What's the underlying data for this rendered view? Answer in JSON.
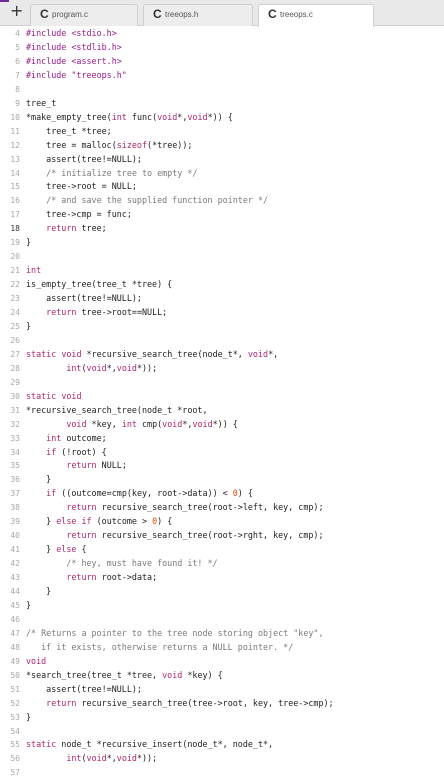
{
  "tabs": {
    "new_tab_symbol": "+",
    "items": [
      {
        "label": "program.c",
        "icon": "c-file-icon",
        "icon_glyph": "C"
      },
      {
        "label": "treeops.h",
        "icon": "c-file-icon",
        "icon_glyph": "C"
      },
      {
        "label": "treeops.c",
        "icon": "c-file-icon",
        "icon_glyph": "C",
        "active": true
      }
    ]
  },
  "editor": {
    "current_line": "18",
    "lines": [
      {
        "n": "4",
        "tokens": [
          {
            "t": "#include <stdio.h>",
            "c": "pp"
          }
        ]
      },
      {
        "n": "5",
        "tokens": [
          {
            "t": "#include <stdlib.h>",
            "c": "pp"
          }
        ]
      },
      {
        "n": "6",
        "tokens": [
          {
            "t": "#include <assert.h>",
            "c": "pp"
          }
        ]
      },
      {
        "n": "7",
        "tokens": [
          {
            "t": "#include \"treeops.h\"",
            "c": "pp"
          }
        ]
      },
      {
        "n": "8",
        "tokens": []
      },
      {
        "n": "9",
        "tokens": [
          {
            "t": "tree_t",
            "c": ""
          }
        ]
      },
      {
        "n": "10",
        "tokens": [
          {
            "t": "*make_empty_tree(",
            "c": ""
          },
          {
            "t": "int",
            "c": "kw"
          },
          {
            "t": " func(",
            "c": ""
          },
          {
            "t": "void",
            "c": "kw"
          },
          {
            "t": "*,",
            "c": ""
          },
          {
            "t": "void",
            "c": "kw"
          },
          {
            "t": "*)) {",
            "c": ""
          }
        ]
      },
      {
        "n": "11",
        "tokens": [
          {
            "t": "    tree_t *tree;",
            "c": ""
          }
        ]
      },
      {
        "n": "12",
        "tokens": [
          {
            "t": "    tree = malloc(",
            "c": ""
          },
          {
            "t": "sizeof",
            "c": "kw"
          },
          {
            "t": "(*tree));",
            "c": ""
          }
        ]
      },
      {
        "n": "13",
        "tokens": [
          {
            "t": "    assert(tree!=NULL);",
            "c": ""
          }
        ]
      },
      {
        "n": "14",
        "tokens": [
          {
            "t": "    /* initialize tree to empty */",
            "c": "cmt"
          }
        ]
      },
      {
        "n": "15",
        "tokens": [
          {
            "t": "    tree->root = NULL;",
            "c": ""
          }
        ]
      },
      {
        "n": "16",
        "tokens": [
          {
            "t": "    /* and save the supplied function pointer */",
            "c": "cmt"
          }
        ]
      },
      {
        "n": "17",
        "tokens": [
          {
            "t": "    tree->cmp = func;",
            "c": ""
          }
        ]
      },
      {
        "n": "18",
        "tokens": [
          {
            "t": "    ",
            "c": ""
          },
          {
            "t": "return",
            "c": "kw"
          },
          {
            "t": " tree;",
            "c": ""
          }
        ]
      },
      {
        "n": "19",
        "tokens": [
          {
            "t": "}",
            "c": ""
          }
        ]
      },
      {
        "n": "20",
        "tokens": []
      },
      {
        "n": "21",
        "tokens": [
          {
            "t": "int",
            "c": "kw"
          }
        ]
      },
      {
        "n": "22",
        "tokens": [
          {
            "t": "is_empty_tree(tree_t *tree) {",
            "c": ""
          }
        ]
      },
      {
        "n": "23",
        "tokens": [
          {
            "t": "    assert(tree!=NULL);",
            "c": ""
          }
        ]
      },
      {
        "n": "24",
        "tokens": [
          {
            "t": "    ",
            "c": ""
          },
          {
            "t": "return",
            "c": "kw"
          },
          {
            "t": " tree->root==NULL;",
            "c": ""
          }
        ]
      },
      {
        "n": "25",
        "tokens": [
          {
            "t": "}",
            "c": ""
          }
        ]
      },
      {
        "n": "26",
        "tokens": []
      },
      {
        "n": "27",
        "tokens": [
          {
            "t": "static",
            "c": "kw"
          },
          {
            "t": " ",
            "c": ""
          },
          {
            "t": "void",
            "c": "kw"
          },
          {
            "t": " *recursive_search_tree(node_t*, ",
            "c": ""
          },
          {
            "t": "void",
            "c": "kw"
          },
          {
            "t": "*,",
            "c": ""
          }
        ]
      },
      {
        "n": "28",
        "tokens": [
          {
            "t": "        ",
            "c": ""
          },
          {
            "t": "int",
            "c": "kw"
          },
          {
            "t": "(",
            "c": ""
          },
          {
            "t": "void",
            "c": "kw"
          },
          {
            "t": "*,",
            "c": ""
          },
          {
            "t": "void",
            "c": "kw"
          },
          {
            "t": "*));",
            "c": ""
          }
        ]
      },
      {
        "n": "29",
        "tokens": []
      },
      {
        "n": "30",
        "tokens": [
          {
            "t": "static",
            "c": "kw"
          },
          {
            "t": " ",
            "c": ""
          },
          {
            "t": "void",
            "c": "kw"
          }
        ]
      },
      {
        "n": "31",
        "tokens": [
          {
            "t": "*recursive_search_tree(node_t *root,",
            "c": ""
          }
        ]
      },
      {
        "n": "32",
        "tokens": [
          {
            "t": "        ",
            "c": ""
          },
          {
            "t": "void",
            "c": "kw"
          },
          {
            "t": " *key, ",
            "c": ""
          },
          {
            "t": "int",
            "c": "kw"
          },
          {
            "t": " cmp(",
            "c": ""
          },
          {
            "t": "void",
            "c": "kw"
          },
          {
            "t": "*,",
            "c": ""
          },
          {
            "t": "void",
            "c": "kw"
          },
          {
            "t": "*)) {",
            "c": ""
          }
        ]
      },
      {
        "n": "33",
        "tokens": [
          {
            "t": "    ",
            "c": ""
          },
          {
            "t": "int",
            "c": "kw"
          },
          {
            "t": " outcome;",
            "c": ""
          }
        ]
      },
      {
        "n": "34",
        "tokens": [
          {
            "t": "    ",
            "c": ""
          },
          {
            "t": "if",
            "c": "kw"
          },
          {
            "t": " (!root) {",
            "c": ""
          }
        ]
      },
      {
        "n": "35",
        "tokens": [
          {
            "t": "        ",
            "c": ""
          },
          {
            "t": "return",
            "c": "kw"
          },
          {
            "t": " NULL;",
            "c": ""
          }
        ]
      },
      {
        "n": "36",
        "tokens": [
          {
            "t": "    }",
            "c": ""
          }
        ]
      },
      {
        "n": "37",
        "tokens": [
          {
            "t": "    ",
            "c": ""
          },
          {
            "t": "if",
            "c": "kw"
          },
          {
            "t": " ((outcome=cmp(key, root->data)) < ",
            "c": ""
          },
          {
            "t": "0",
            "c": "num"
          },
          {
            "t": ") {",
            "c": ""
          }
        ]
      },
      {
        "n": "38",
        "tokens": [
          {
            "t": "        ",
            "c": ""
          },
          {
            "t": "return",
            "c": "kw"
          },
          {
            "t": " recursive_search_tree(root->left, key, cmp);",
            "c": ""
          }
        ]
      },
      {
        "n": "39",
        "tokens": [
          {
            "t": "    } ",
            "c": ""
          },
          {
            "t": "else if",
            "c": "kw"
          },
          {
            "t": " (outcome > ",
            "c": ""
          },
          {
            "t": "0",
            "c": "num"
          },
          {
            "t": ") {",
            "c": ""
          }
        ]
      },
      {
        "n": "40",
        "tokens": [
          {
            "t": "        ",
            "c": ""
          },
          {
            "t": "return",
            "c": "kw"
          },
          {
            "t": " recursive_search_tree(root->rght, key, cmp);",
            "c": ""
          }
        ]
      },
      {
        "n": "41",
        "tokens": [
          {
            "t": "    } ",
            "c": ""
          },
          {
            "t": "else",
            "c": "kw"
          },
          {
            "t": " {",
            "c": ""
          }
        ]
      },
      {
        "n": "42",
        "tokens": [
          {
            "t": "        /* hey, must have found it! */",
            "c": "cmt"
          }
        ]
      },
      {
        "n": "43",
        "tokens": [
          {
            "t": "        ",
            "c": ""
          },
          {
            "t": "return",
            "c": "kw"
          },
          {
            "t": " root->data;",
            "c": ""
          }
        ]
      },
      {
        "n": "44",
        "tokens": [
          {
            "t": "    }",
            "c": ""
          }
        ]
      },
      {
        "n": "45",
        "tokens": [
          {
            "t": "}",
            "c": ""
          }
        ]
      },
      {
        "n": "46",
        "tokens": []
      },
      {
        "n": "47",
        "tokens": [
          {
            "t": "/* Returns a pointer to the tree node storing object \"key\",",
            "c": "cmt"
          }
        ]
      },
      {
        "n": "48",
        "tokens": [
          {
            "t": "   if it exists, otherwise returns a NULL pointer. */",
            "c": "cmt"
          }
        ]
      },
      {
        "n": "49",
        "tokens": [
          {
            "t": "void",
            "c": "kw"
          }
        ]
      },
      {
        "n": "50",
        "tokens": [
          {
            "t": "*search_tree(tree_t *tree, ",
            "c": ""
          },
          {
            "t": "void",
            "c": "kw"
          },
          {
            "t": " *key) {",
            "c": ""
          }
        ]
      },
      {
        "n": "51",
        "tokens": [
          {
            "t": "    assert(tree!=NULL);",
            "c": ""
          }
        ]
      },
      {
        "n": "52",
        "tokens": [
          {
            "t": "    ",
            "c": ""
          },
          {
            "t": "return",
            "c": "kw"
          },
          {
            "t": " recursive_search_tree(tree->root, key, tree->cmp);",
            "c": ""
          }
        ]
      },
      {
        "n": "53",
        "tokens": [
          {
            "t": "}",
            "c": ""
          }
        ]
      },
      {
        "n": "54",
        "tokens": []
      },
      {
        "n": "55",
        "tokens": [
          {
            "t": "static",
            "c": "kw"
          },
          {
            "t": " node_t *recursive_insert(node_t*, node_t*,",
            "c": ""
          }
        ]
      },
      {
        "n": "56",
        "tokens": [
          {
            "t": "        ",
            "c": ""
          },
          {
            "t": "int",
            "c": "kw"
          },
          {
            "t": "(",
            "c": ""
          },
          {
            "t": "void",
            "c": "kw"
          },
          {
            "t": "*,",
            "c": ""
          },
          {
            "t": "void",
            "c": "kw"
          },
          {
            "t": "*));",
            "c": ""
          }
        ]
      },
      {
        "n": "57",
        "tokens": []
      }
    ]
  }
}
